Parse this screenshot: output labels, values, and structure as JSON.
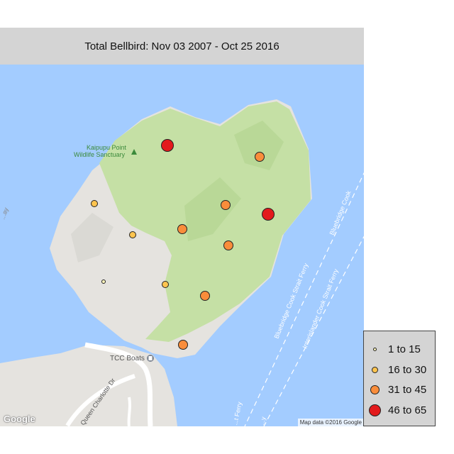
{
  "title": "Total Bellbird: Nov 03 2007 - Oct 25 2016",
  "map": {
    "place_labels": {
      "sanctuary_line1": "Kaipupu Point",
      "sanctuary_line2": "Wildlife Sanctuary",
      "tcc_boats": "TCC Boats",
      "road": "Queen Charlotte Dr",
      "ferry1": "Bluebridge Cook Strait Ferry",
      "ferry2": "Bluebridge Cook",
      "ferry3": "Interislander Cook Strait Ferry",
      "ferry4": "...t Ferry",
      "ferry5": "...y",
      "edge_left": "...ay"
    },
    "google_logo": "Google",
    "attribution": "Map data ©2016 Google",
    "colors": {
      "water": "#a3ccff",
      "land": "#e5e3df",
      "green": "#c5e0a5"
    }
  },
  "legend": {
    "items": [
      {
        "label": "1 to 15",
        "color": "#fff7bc"
      },
      {
        "label": "16 to 30",
        "color": "#fec44f"
      },
      {
        "label": "31 to 45",
        "color": "#f98d3b"
      },
      {
        "label": "46 to 65",
        "color": "#e31a1c"
      }
    ]
  },
  "points": [
    {
      "bin": 3
    },
    {
      "bin": 2
    },
    {
      "bin": 1
    },
    {
      "bin": 1
    },
    {
      "bin": 2
    },
    {
      "bin": 3
    },
    {
      "bin": 2
    },
    {
      "bin": 2
    },
    {
      "bin": 0
    },
    {
      "bin": 1
    },
    {
      "bin": 2
    },
    {
      "bin": 2
    }
  ]
}
